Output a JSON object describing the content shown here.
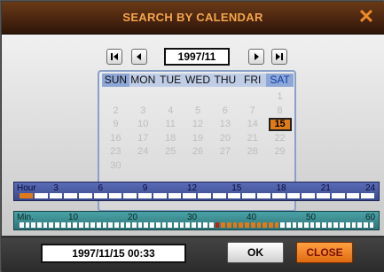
{
  "dialog": {
    "title": "SEARCH BY CALENDAR",
    "close_glyph": "✕"
  },
  "nav": {
    "month": "1997/11"
  },
  "calendar": {
    "weekdays": [
      "SUN",
      "MON",
      "TUE",
      "WED",
      "THU",
      "FRI",
      "SAT"
    ],
    "days": [
      "1",
      "2",
      "3",
      "4",
      "5",
      "6",
      "7",
      "8",
      "9",
      "10",
      "11",
      "12",
      "13",
      "14",
      "15",
      "16",
      "17",
      "18",
      "19",
      "20",
      "21",
      "22",
      "23",
      "24",
      "25",
      "26",
      "27",
      "28",
      "29",
      "30"
    ],
    "first_weekday_index": 6,
    "selected_day": "15"
  },
  "hour_bar": {
    "label": "Hour",
    "ticks": [
      "3",
      "6",
      "9",
      "12",
      "15",
      "18",
      "21",
      "24"
    ],
    "segments": 24,
    "highlighted": [
      0
    ],
    "highlight_color": "#e07a18"
  },
  "minute_bar": {
    "label": "Min.",
    "ticks": [
      "10",
      "20",
      "30",
      "40",
      "50",
      "60"
    ],
    "segments": 60,
    "highlighted": [
      33,
      34,
      35,
      36,
      37,
      38,
      39,
      40,
      41,
      42,
      43
    ],
    "current": 33,
    "highlight_color": "#e07a18",
    "current_color": "#c02010"
  },
  "footer": {
    "datetime": "1997/11/15 00:33",
    "ok_label": "OK",
    "close_label": "CLOSE"
  }
}
